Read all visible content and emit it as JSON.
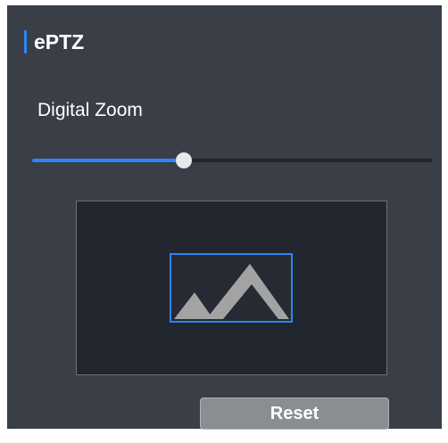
{
  "section": {
    "title": "ePTZ"
  },
  "zoom": {
    "label": "Digital Zoom",
    "value_percent": 38
  },
  "preview": {
    "icon": "image-landscape-icon"
  },
  "actions": {
    "reset_label": "Reset"
  },
  "colors": {
    "accent": "#2b86f2",
    "panel_background": "#393e47",
    "preview_background": "#22262f",
    "mountain": "#a3a3a3",
    "button_background": "#8a8d91"
  }
}
